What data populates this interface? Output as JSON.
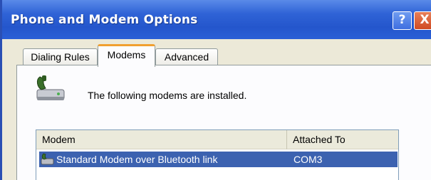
{
  "window": {
    "title": "Phone and Modem Options",
    "help_glyph": "?",
    "close_glyph": "X"
  },
  "tabs": [
    {
      "label": "Dialing Rules",
      "selected": false
    },
    {
      "label": "Modems",
      "selected": true
    },
    {
      "label": "Advanced",
      "selected": false
    }
  ],
  "modems_tab": {
    "intro_text": "The following modems are installed.",
    "icon": "phone-modem-icon",
    "columns": [
      "Modem",
      "Attached To"
    ],
    "rows": [
      {
        "modem": "Standard Modem over Bluetooth link",
        "attached_to": "COM3",
        "icon": "modem-icon",
        "selected": true
      }
    ]
  },
  "colors": {
    "title_bar": "#2456cc",
    "selection": "#3c62b0",
    "tab_highlight": "#f0a030",
    "dialog_bg": "#ece9d8"
  }
}
